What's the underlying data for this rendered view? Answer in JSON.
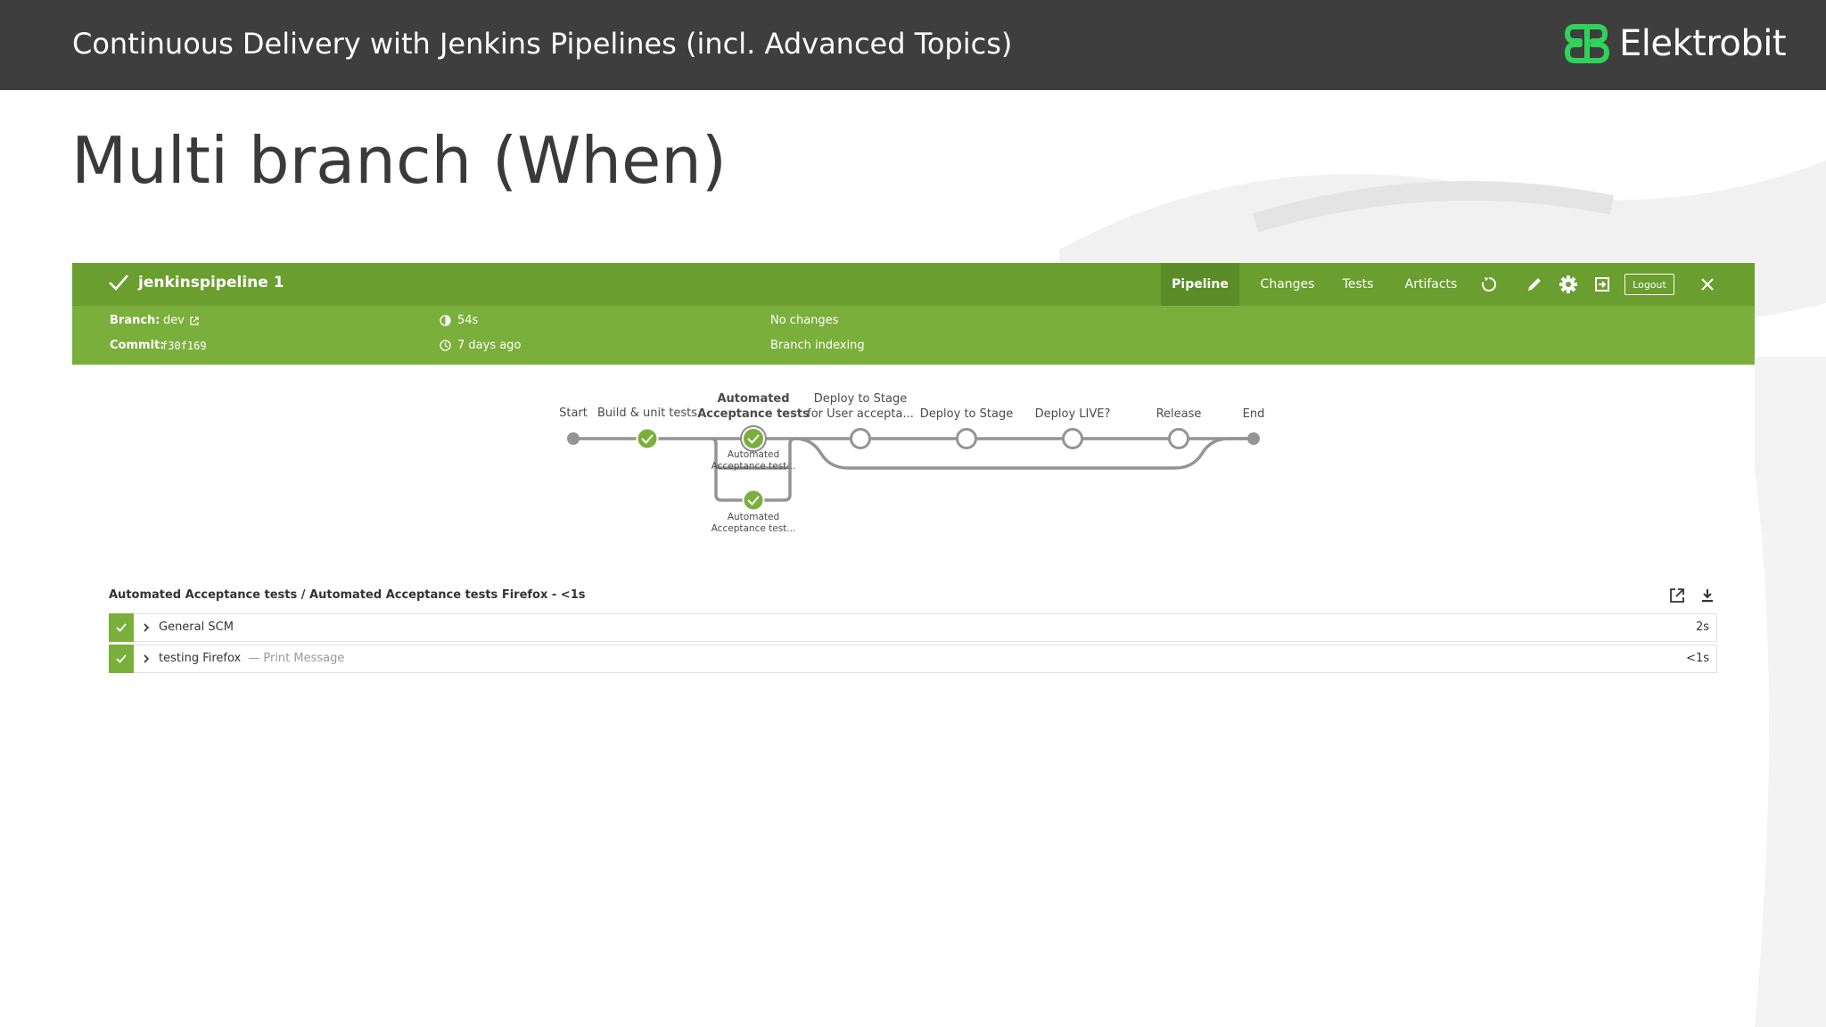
{
  "slide": {
    "header_title": "Continuous Delivery with Jenkins Pipelines (incl. Advanced Topics)",
    "logo_name": "Elektrobit",
    "title": "Multi branch (When)"
  },
  "jenkins": {
    "pipeline_name": "jenkinspipeline 1",
    "nav": {
      "pipeline": "Pipeline",
      "changes": "Changes",
      "tests": "Tests",
      "artifacts": "Artifacts",
      "logout": "Logout"
    },
    "meta": {
      "branch_label": "Branch:",
      "branch_value": "dev",
      "commit_label": "Commit:",
      "commit_value": "f30f169",
      "duration": "54s",
      "time_ago": "7 days ago",
      "changes": "No changes",
      "cause": "Branch indexing"
    },
    "colors": {
      "bar_dark": "#6a9e2f",
      "bar_light": "#7aaf3c",
      "success": "#7aaf3c"
    },
    "stages": {
      "start": "Start",
      "build": "Build & unit tests",
      "aat_line1": "Automated",
      "aat_line2": "Acceptance tests",
      "dtsu_line1": "Deploy to Stage",
      "dtsu_line2": "for User accepta...",
      "dts": "Deploy to Stage",
      "live": "Deploy LIVE?",
      "release": "Release",
      "end": "End",
      "parallel1_line1": "Automated",
      "parallel1_line2": "Acceptance test...",
      "parallel2_line1": "Automated",
      "parallel2_line2": "Acceptance test..."
    },
    "steps": {
      "title": "Automated Acceptance tests / Automated Acceptance tests Firefox - <1s",
      "items": [
        {
          "name": "General SCM",
          "desc": "",
          "time": "2s"
        },
        {
          "name": "testing Firefox",
          "desc": "— Print Message",
          "time": "<1s"
        }
      ]
    }
  }
}
